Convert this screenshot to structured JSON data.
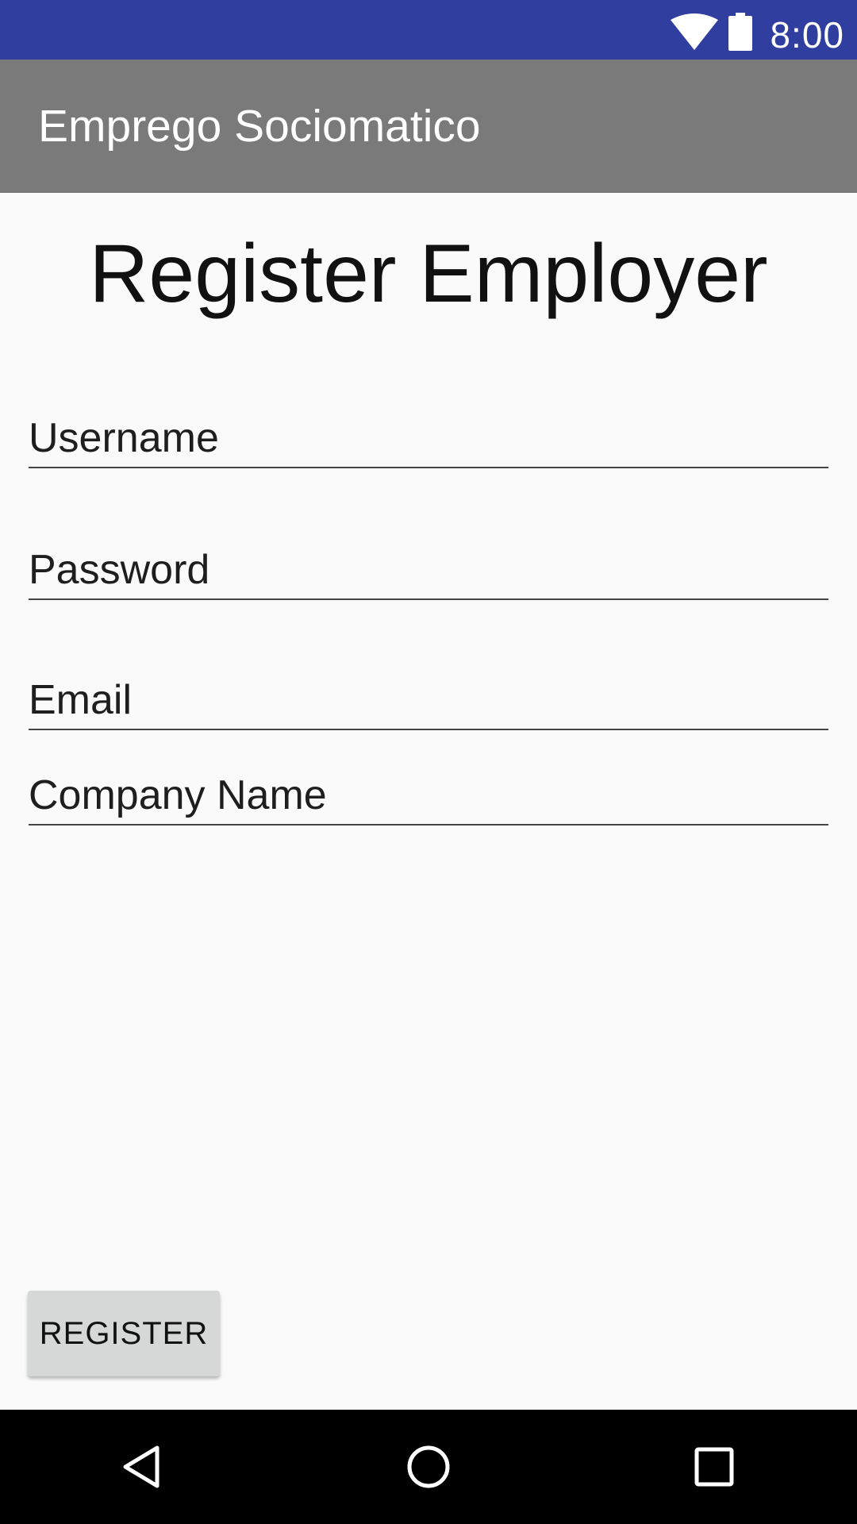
{
  "status_bar": {
    "time": "8:00",
    "icons": [
      "wifi-icon",
      "battery-icon"
    ],
    "background_color": "#303f9f"
  },
  "app_bar": {
    "title": "Emprego Sociomatico",
    "background_color": "#7a7a7a"
  },
  "form": {
    "heading": "Register Employer",
    "fields": [
      {
        "name": "username",
        "placeholder": "Username",
        "value": ""
      },
      {
        "name": "password",
        "placeholder": "Password",
        "value": ""
      },
      {
        "name": "email",
        "placeholder": "Email",
        "value": ""
      },
      {
        "name": "company_name",
        "placeholder": "Company Name",
        "value": ""
      }
    ],
    "register_label": "REGISTER"
  },
  "nav_bar": {
    "buttons": [
      "back-icon",
      "home-icon",
      "recent-apps-icon"
    ]
  }
}
